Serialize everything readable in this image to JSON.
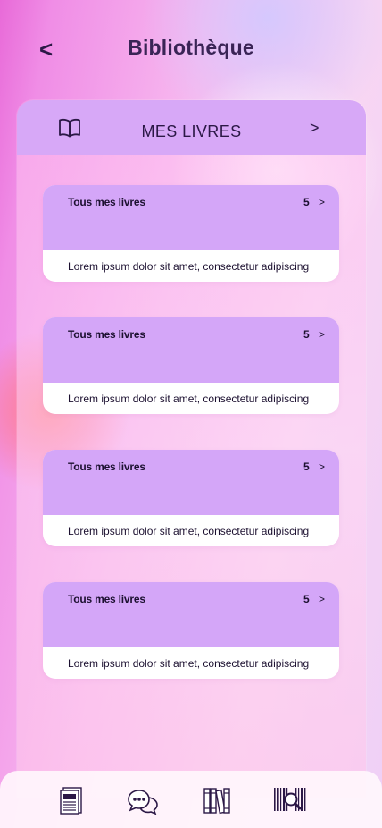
{
  "header": {
    "back_label": "<",
    "title": "Bibliothèque"
  },
  "panel": {
    "title": "MES LIVRES",
    "next_label": ">",
    "icon": "open-book-icon"
  },
  "cards": [
    {
      "title": "Tous mes livres",
      "count": "5",
      "arrow": ">",
      "description": "Lorem ipsum dolor sit amet, consectetur adipiscing"
    },
    {
      "title": "Tous mes livres",
      "count": "5",
      "arrow": ">",
      "description": "Lorem ipsum dolor sit amet, consectetur adipiscing"
    },
    {
      "title": "Tous mes livres",
      "count": "5",
      "arrow": ">",
      "description": "Lorem ipsum dolor sit amet, consectetur adipiscing"
    },
    {
      "title": "Tous mes livres",
      "count": "5",
      "arrow": ">",
      "description": "Lorem ipsum dolor sit amet, consectetur adipiscing"
    }
  ],
  "bottom_nav": {
    "items": [
      "newspaper-icon",
      "chat-bubbles-icon",
      "bookshelf-icon",
      "barcode-scan-icon"
    ]
  },
  "colors": {
    "accent": "#d4a6f8",
    "panel_header": "#d7a8f7",
    "text_dark": "#1c1030"
  }
}
